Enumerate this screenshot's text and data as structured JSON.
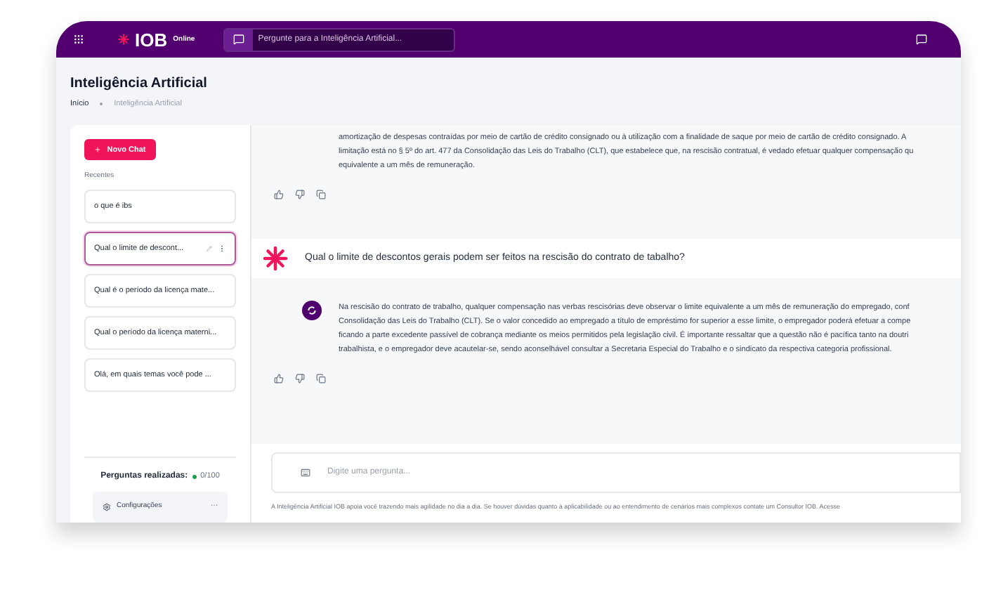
{
  "header": {
    "logo": "IOB",
    "logo_suffix": "Online",
    "search": {
      "placeholder": "Pergunte para a Inteligência Artificial..."
    }
  },
  "page": {
    "title": "Inteligência Artificial",
    "breadcrumb": [
      "Início",
      "Inteligência Artificial"
    ]
  },
  "sidebar": {
    "new_chat": "Novo Chat",
    "section": "Recentes",
    "items": [
      {
        "label": "o que é ibs",
        "selected": false
      },
      {
        "label": "Qual o limite de descont...",
        "selected": true
      },
      {
        "label": "Qual é o período da licença mate...",
        "selected": false
      },
      {
        "label": "Qual o período da licença materni...",
        "selected": false
      },
      {
        "label": "Olá, em quais temas você pode ...",
        "selected": false
      }
    ],
    "usage": {
      "label": "Perguntas realizadas:",
      "count": "0/100",
      "color": "#22a04b"
    },
    "settings": {
      "label": "Configurações",
      "more": "···"
    }
  },
  "chat": {
    "messages": [
      {
        "kind": "answer",
        "partial": true,
        "lines": [
          "amortização de despesas contraídas por meio de cartão de crédito consignado ou à utilização com a finalidade de saque por meio de cartão de crédito consignado. A",
          "limitação está no § 5º do art. 477 da Consolidação das Leis do Trabalho (CLT), que estabelece que, na rescisão contratual, é vedado efetuar qualquer compensação qu",
          "equivalente a um mês de remuneração."
        ]
      },
      {
        "kind": "question",
        "lines": [
          "Qual o limite de descontos gerais podem ser feitos na rescisão do contrato de tabalho?"
        ]
      },
      {
        "kind": "answer",
        "partial": false,
        "lines": [
          "Na rescisão do contrato de trabalho, qualquer compensação nas verbas rescisórias deve observar o limite equivalente a um mês de remuneração do empregado, conf",
          "Consolidação das Leis do Trabalho (CLT). Se o valor concedido ao empregado a título de empréstimo for superior a esse limite, o empregador poderá efetuar a compe",
          "ficando a parte excedente passível de cobrança mediante os meios permitidos pela legislação civil. É importante ressaltar que a questão não é pacífica tanto na doutri",
          "trabalhista, e o empregador deve acautelar-se, sendo aconselhável consultar a Secretaria Especial do Trabalho e o sindicato da respectiva categoria profissional."
        ]
      }
    ],
    "input": {
      "placeholder": "Digite uma pergunta..."
    },
    "disclaimer": "A Inteligência Artificial IOB apoia você trazendo mais agilidade no dia a dia. Se houver dúvidas quanto à aplicabilidade ou ao entendimento de cenários mais complexos contate um Consultor IOB. Acesse"
  }
}
